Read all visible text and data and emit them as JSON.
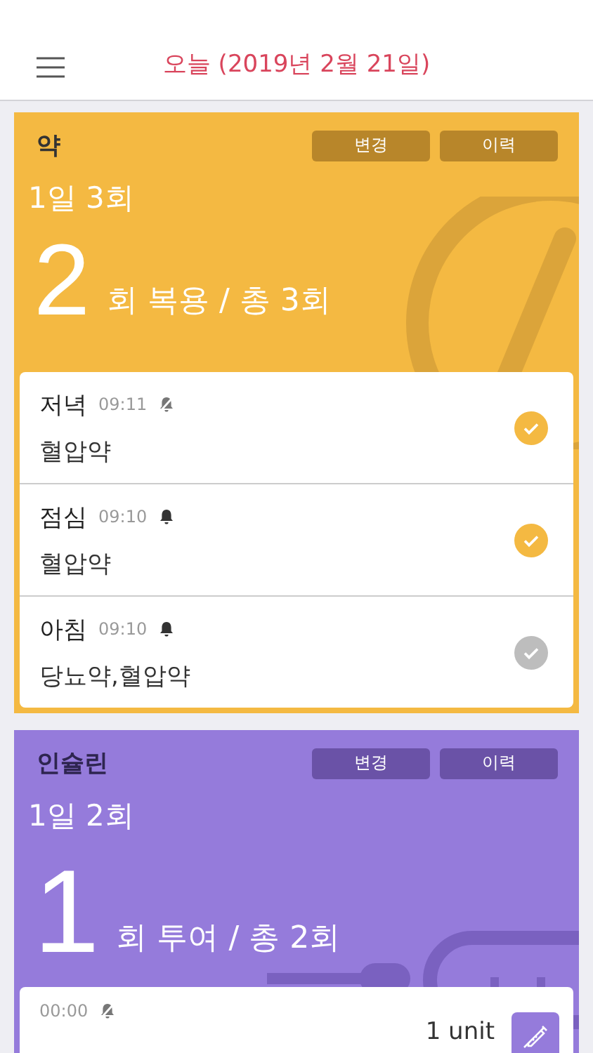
{
  "header": {
    "title": "오늘 (2019년 2월 21일)"
  },
  "cards": [
    {
      "kind": "pill",
      "title": "약",
      "buttons": [
        "변경",
        "이력"
      ],
      "schedule": "1일 3회",
      "count": "2",
      "summary": "회 복용 / 총 3회",
      "doses": [
        {
          "label": "저녁",
          "time": "09:11",
          "alarm": false,
          "name": "혈압약",
          "taken": true
        },
        {
          "label": "점심",
          "time": "09:10",
          "alarm": true,
          "name": "혈압약",
          "taken": true
        },
        {
          "label": "아침",
          "time": "09:10",
          "alarm": true,
          "name": "당뇨약,혈압약",
          "taken": false
        }
      ]
    },
    {
      "kind": "insulin",
      "title": "인슐린",
      "buttons": [
        "변경",
        "이력"
      ],
      "schedule": "1일 2회",
      "count": "1",
      "summary": "회 투여 / 총 2회",
      "doses": [
        {
          "time": "00:00",
          "alarm": false,
          "amount": "1 unit"
        }
      ]
    }
  ]
}
